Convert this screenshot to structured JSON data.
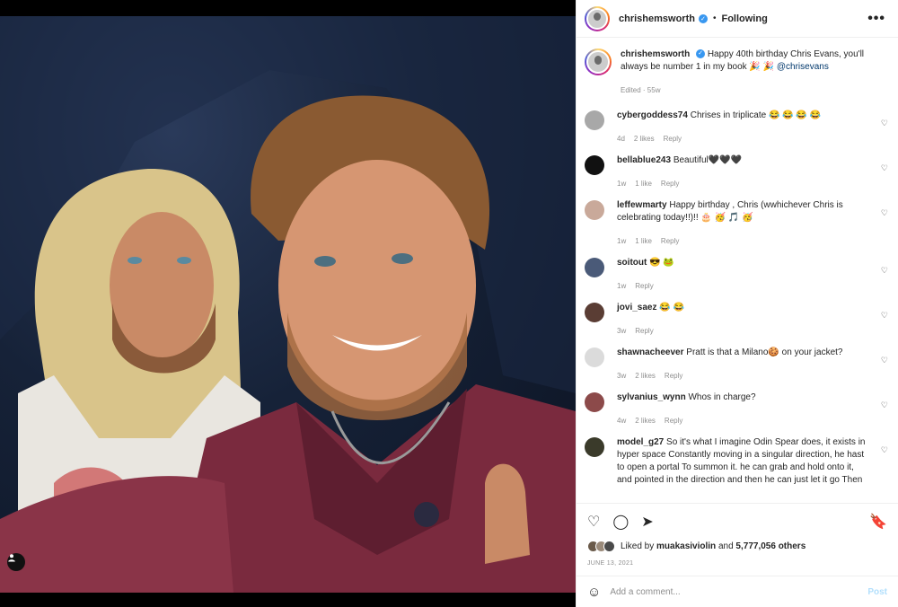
{
  "post": {
    "username": "chrishemsworth",
    "follow_label": "Following",
    "separator": "•",
    "more_label": "•••",
    "caption_text": "Happy 40th birthday Chris Evans, you'll always be number 1 in my book 🎉 🎉",
    "caption_mention": "@chrisevans",
    "caption_meta": "Edited · 55w"
  },
  "comments": [
    {
      "user": "cybergoddess74",
      "text": "Chrises in triplicate 😂 😂 😂 😂",
      "time": "4d",
      "likes": "2 likes",
      "reply": "Reply",
      "avatar_color": "#a8a8a8"
    },
    {
      "user": "bellablue243",
      "text": "Beautiful🖤🖤🖤",
      "time": "1w",
      "likes": "1 like",
      "reply": "Reply",
      "avatar_color": "#111111"
    },
    {
      "user": "leffewmarty",
      "text": "Happy birthday , Chris (wwhichever Chris is celebrating today!!)!! 🎂 🥳 🎵 🥳",
      "time": "1w",
      "likes": "1 like",
      "reply": "Reply",
      "avatar_color": "#c9a99a"
    },
    {
      "user": "soitout",
      "text": "😎 🐸",
      "time": "1w",
      "likes": "",
      "reply": "Reply",
      "avatar_color": "#4a5a78"
    },
    {
      "user": "jovi_saez",
      "text": "😂 😂",
      "time": "3w",
      "likes": "",
      "reply": "Reply",
      "avatar_color": "#5a3d34"
    },
    {
      "user": "shawnacheever",
      "text": "Pratt is that a Milano🍪 on your jacket?",
      "time": "3w",
      "likes": "2 likes",
      "reply": "Reply",
      "avatar_color": "#dbdbdb"
    },
    {
      "user": "sylvanius_wynn",
      "text": "Whos in charge?",
      "time": "4w",
      "likes": "2 likes",
      "reply": "Reply",
      "avatar_color": "#8c4a4a"
    },
    {
      "user": "model_g27",
      "text": "So it's what I imagine Odin Spear does, it exists in hyper space Constantly moving in a singular direction, he hast to open a portal To summon it. he can grab and hold onto it, and pointed in the direction and then he can just let it go Then",
      "time": "",
      "likes": "",
      "reply": "",
      "avatar_color": "#3a3a2a"
    }
  ],
  "actions": {
    "like_icon": "heart-icon",
    "comment_icon": "comment-icon",
    "share_icon": "share-icon",
    "save_icon": "bookmark-icon"
  },
  "likes": {
    "prefix": "Liked by",
    "user": "muakasiviolin",
    "middle": "and",
    "count": "5,777,056 others"
  },
  "date": "JUNE 13, 2021",
  "add_comment": {
    "placeholder": "Add a comment...",
    "post_label": "Post"
  }
}
